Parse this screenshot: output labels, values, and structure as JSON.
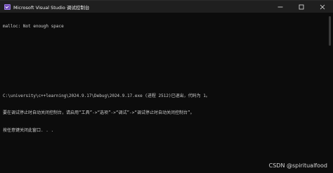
{
  "window": {
    "title": "Microsoft Visual Studio 调试控制台",
    "app_icon": "visual-studio-icon",
    "controls": {
      "minimize_icon": "minimize-icon",
      "maximize_icon": "maximize-icon",
      "close_icon": "close-icon"
    }
  },
  "console": {
    "lines": [
      "malloc: Not enough space",
      "",
      "",
      "",
      "C:\\university\\c++learning\\2024.9.17\\Debug\\2024.9.17.exe (进程 2512)已退出，代码为 1。",
      "要在调试停止时自动关闭控制台，请启用“工具”->“选项”->“调试”->“调试停止时自动关闭控制台”。",
      "按任意键关闭此窗口. . ."
    ]
  },
  "watermark": {
    "text": "CSDN @spiritualfood"
  },
  "colors": {
    "background": "#0c0c0c",
    "titlebar": "#1f1f1f",
    "text": "#cccccc"
  }
}
